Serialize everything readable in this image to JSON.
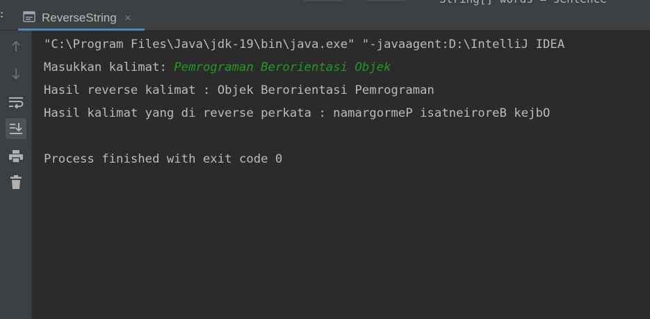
{
  "top_cutoff_text": "String[] words = sentence",
  "run_tab": {
    "label": "ReverseString",
    "close_glyph": "×",
    "icon": "console-icon"
  },
  "toolbar": [
    {
      "icon": "arrow-up-icon",
      "active": false
    },
    {
      "icon": "arrow-down-icon",
      "active": false
    },
    {
      "icon": "soft-wrap-icon",
      "active": false
    },
    {
      "icon": "scroll-to-end-icon",
      "active": true
    },
    {
      "icon": "print-icon",
      "active": false
    },
    {
      "icon": "trash-icon",
      "active": false
    }
  ],
  "console": {
    "command_line": "\"C:\\Program Files\\Java\\jdk-19\\bin\\java.exe\" \"-javaagent:D:\\IntelliJ IDEA",
    "prompt_label": "Masukkan kalimat: ",
    "user_input": "Pemrograman Berorientasi Objek",
    "reverse_sentence": "Hasil reverse kalimat : Objek Berorientasi Pemrograman",
    "reverse_words": "Hasil kalimat yang di reverse perkata : namargormeP isatneiroreB kejbO",
    "exit_message": "Process finished with exit code 0"
  },
  "colors": {
    "background": "#2b2b2b",
    "panel": "#3c3f41",
    "text": "#bbbbbb",
    "user_input": "#1f9a1f",
    "tab_underline": "#4a88c7"
  }
}
